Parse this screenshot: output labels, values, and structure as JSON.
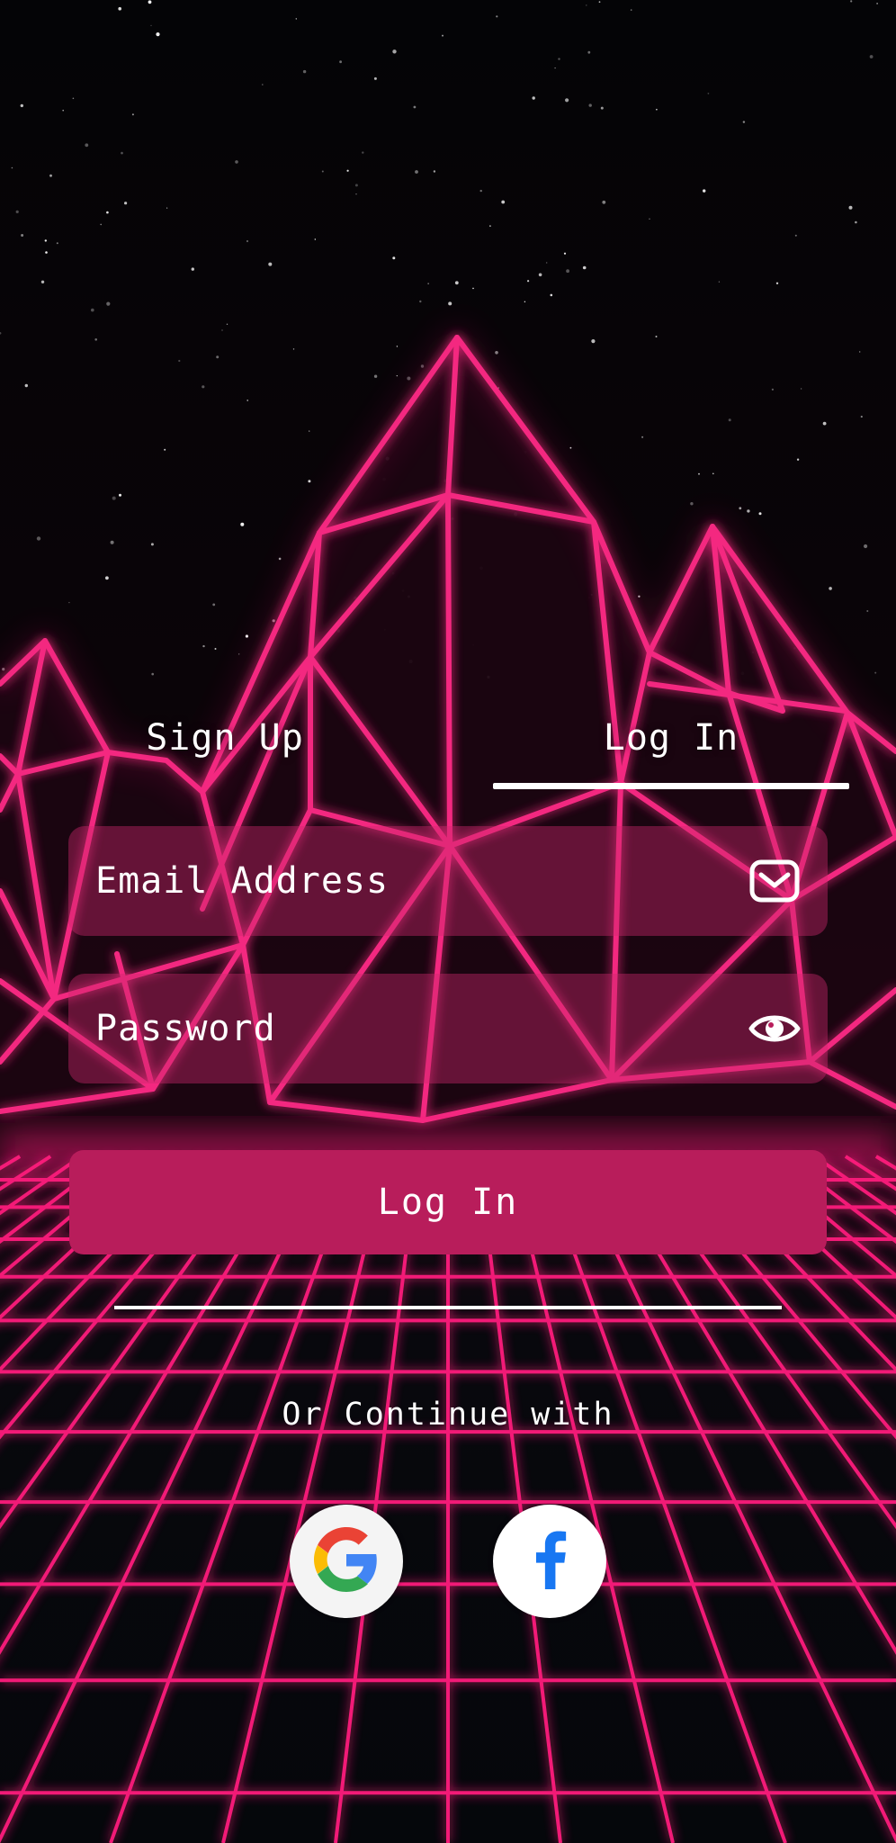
{
  "tabs": {
    "signup_label": "Sign Up",
    "login_label": "Log In",
    "active": "login"
  },
  "form": {
    "email_placeholder": "Email Address",
    "password_placeholder": "Password",
    "email_icon": "envelope-icon",
    "password_icon": "eye-icon",
    "submit_label": "Log In"
  },
  "social": {
    "divider_text": "Or Continue with",
    "providers": [
      {
        "name": "google",
        "icon": "google-icon"
      },
      {
        "name": "facebook",
        "icon": "facebook-icon"
      }
    ]
  },
  "colors": {
    "neon_pink": "#ff1f7d",
    "button_bg": "#b81d5b",
    "field_bg": "#cd286e",
    "background": "#050509",
    "facebook_blue": "#1877f2"
  }
}
